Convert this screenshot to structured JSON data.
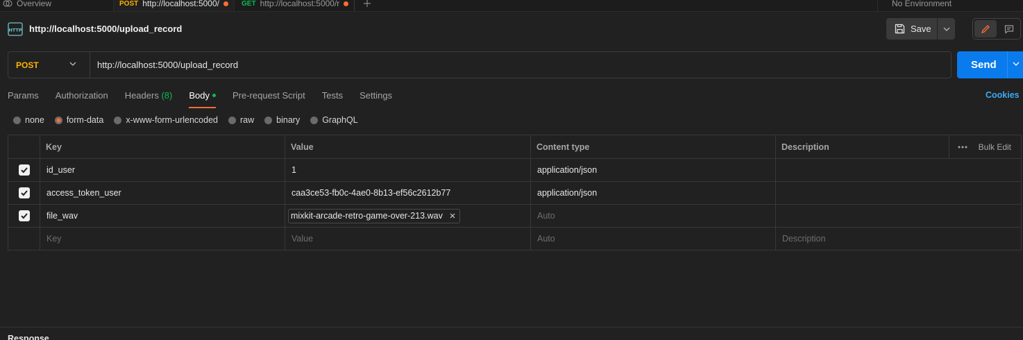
{
  "tabstrip": {
    "overview_label": "Overview",
    "tab1_method": "POST",
    "tab1_url": "http://localhost:5000/",
    "tab2_method": "GET",
    "tab2_url": "http://localhost:5000/r",
    "environment": "No Environment"
  },
  "header": {
    "request_title": "http://localhost:5000/upload_record",
    "save_label": "Save"
  },
  "urlbar": {
    "method": "POST",
    "url": "http://localhost:5000/upload_record",
    "send_label": "Send"
  },
  "request_tabs": {
    "params": "Params",
    "authorization": "Authorization",
    "headers": "Headers",
    "headers_count": "(8)",
    "body": "Body",
    "prerequest": "Pre-request Script",
    "tests": "Tests",
    "settings": "Settings",
    "cookies": "Cookies"
  },
  "body_types": {
    "none": "none",
    "form_data": "form-data",
    "urlencoded": "x-www-form-urlencoded",
    "raw": "raw",
    "binary": "binary",
    "graphql": "GraphQL",
    "selected": "form-data"
  },
  "table": {
    "headers": {
      "key": "Key",
      "value": "Value",
      "content_type": "Content type",
      "description": "Description",
      "bulk_edit": "Bulk Edit"
    },
    "rows": [
      {
        "checked": true,
        "key": "id_user",
        "value": "1",
        "content_type": "application/json",
        "description": ""
      },
      {
        "checked": true,
        "key": "access_token_user",
        "value": "caa3ce53-fb0c-4ae0-8b13-ef56c2612b77",
        "content_type": "application/json",
        "description": ""
      },
      {
        "checked": true,
        "key": "file_wav",
        "value": "mixkit-arcade-retro-game-over-213.wav",
        "content_type": "Auto",
        "description": ""
      }
    ],
    "placeholder": {
      "key": "Key",
      "value": "Value",
      "content_type": "Auto",
      "description": "Description"
    }
  },
  "response": {
    "label": "Response"
  },
  "colors": {
    "accent": "#ff6c37",
    "send": "#097bed",
    "post": "#ffb400",
    "get": "#0cbb52"
  }
}
